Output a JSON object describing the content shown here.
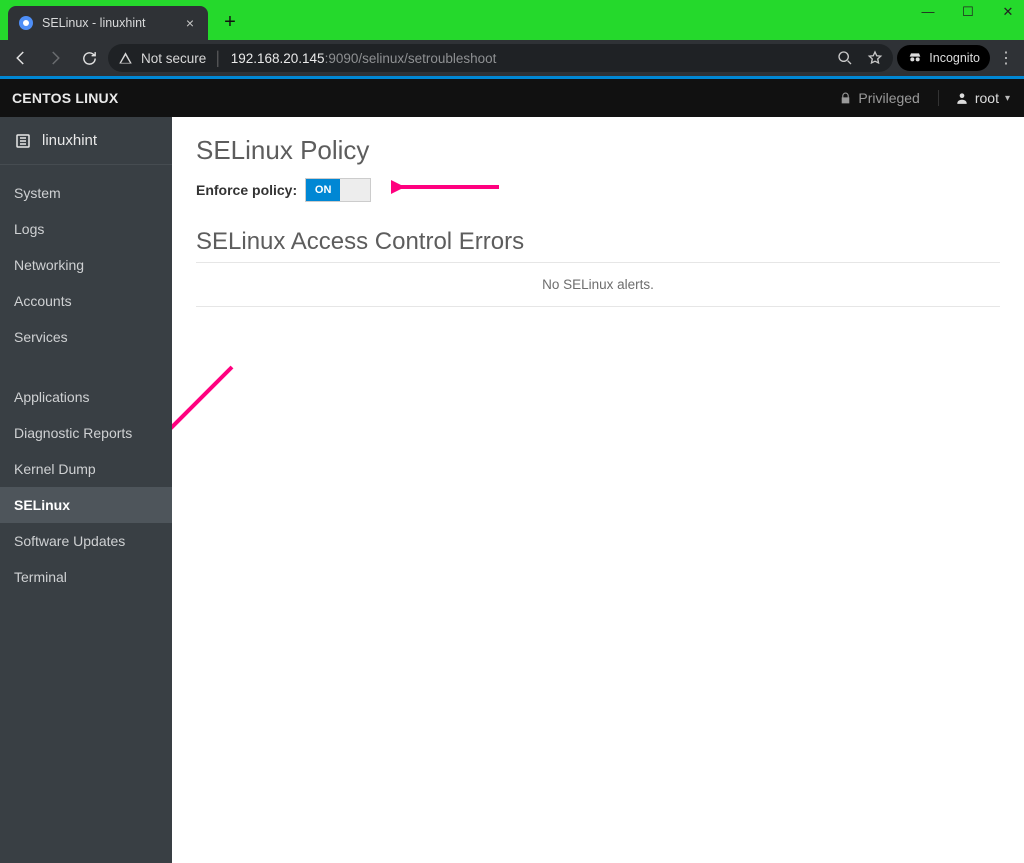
{
  "browser": {
    "tab_title": "SELinux - linuxhint",
    "not_secure_label": "Not secure",
    "url_host_strong": "192.168.20.145",
    "url_port_path": ":9090/selinux/setroubleshoot",
    "incognito_label": "Incognito"
  },
  "topbar": {
    "brand": "CENTOS LINUX",
    "privileged_label": "Privileged",
    "username": "root"
  },
  "sidebar": {
    "hostname": "linuxhint",
    "group1": [
      {
        "label": "System"
      },
      {
        "label": "Logs"
      },
      {
        "label": "Networking"
      },
      {
        "label": "Accounts"
      },
      {
        "label": "Services"
      }
    ],
    "group2": [
      {
        "label": "Applications"
      },
      {
        "label": "Diagnostic Reports"
      },
      {
        "label": "Kernel Dump"
      },
      {
        "label": "SELinux"
      },
      {
        "label": "Software Updates"
      },
      {
        "label": "Terminal"
      }
    ],
    "active_index_group2": 3
  },
  "content": {
    "heading_policy": "SELinux Policy",
    "enforce_label": "Enforce policy:",
    "toggle_on_text": "ON",
    "heading_errors": "SELinux Access Control Errors",
    "empty_alerts": "No SELinux alerts."
  }
}
